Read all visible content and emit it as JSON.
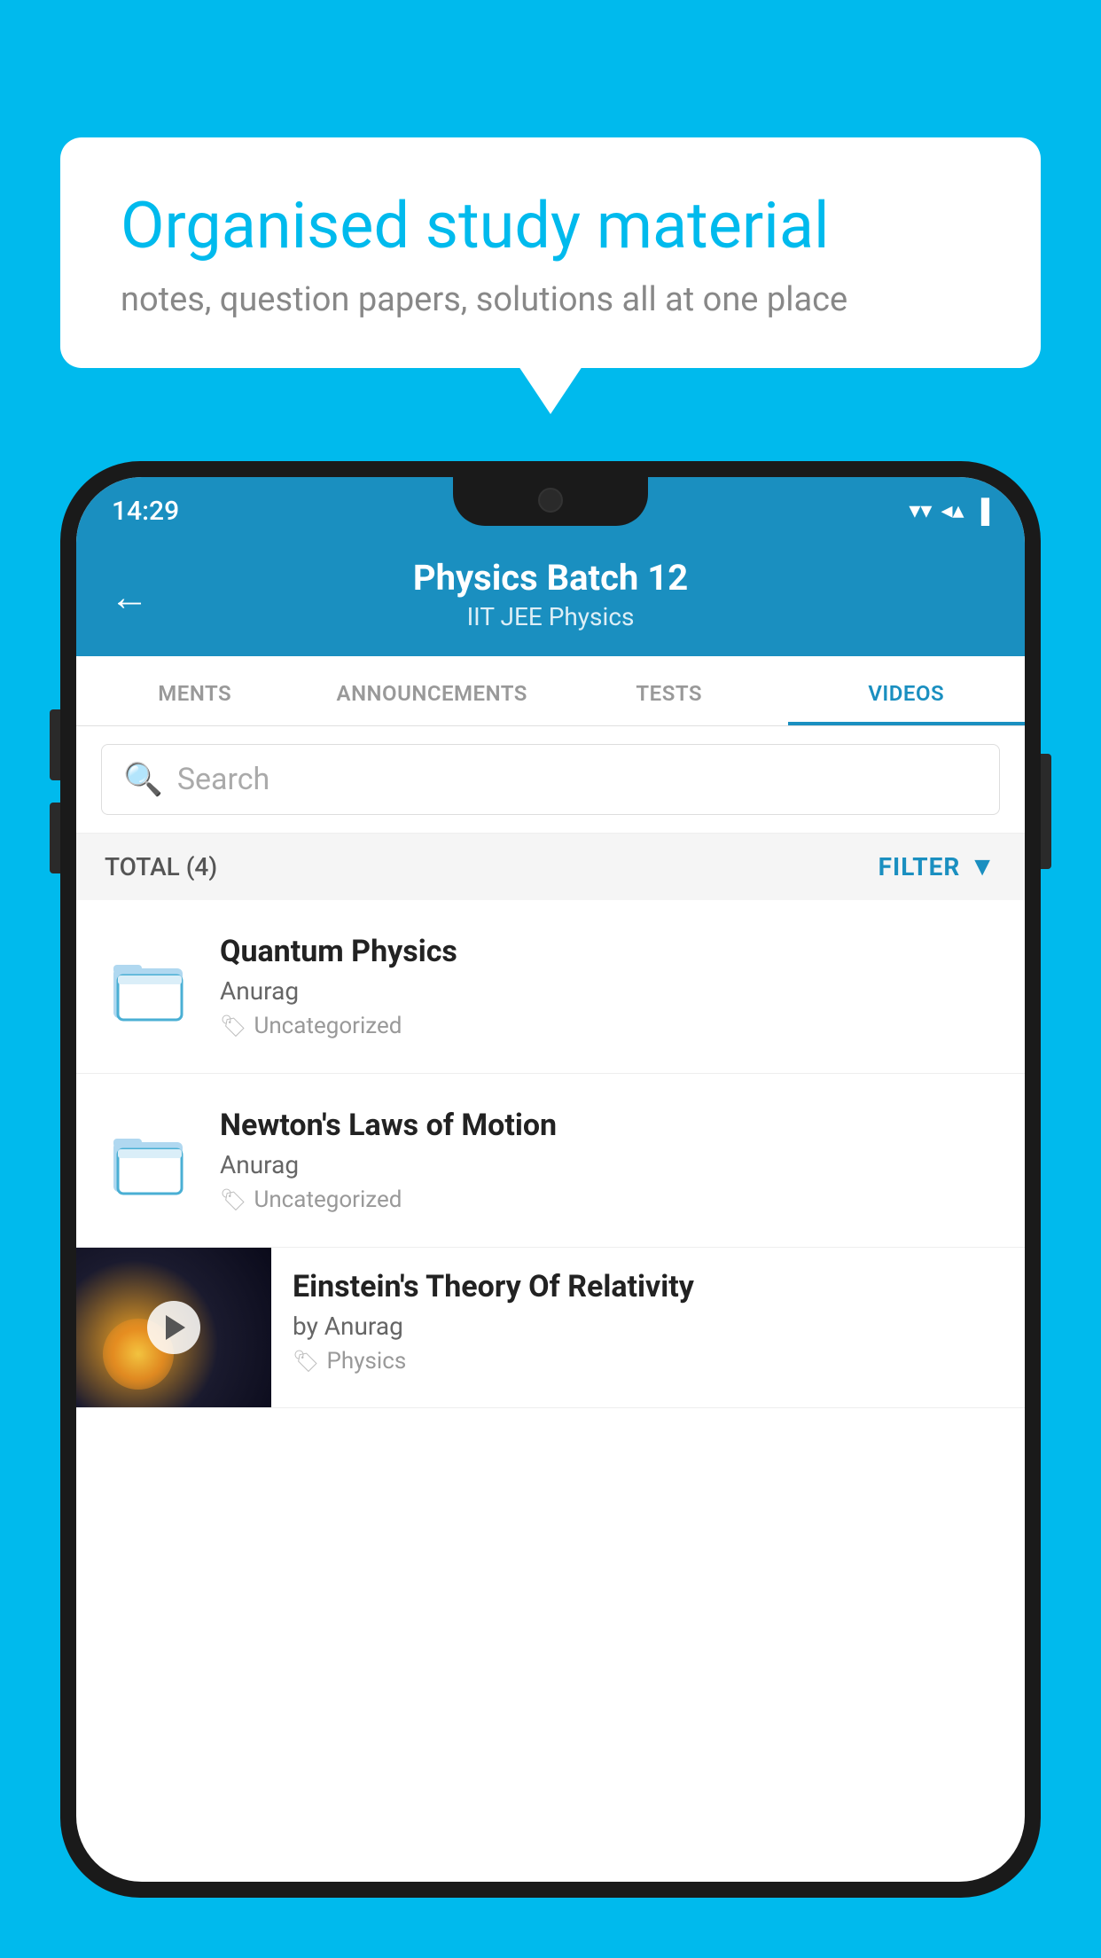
{
  "background_color": "#00BAED",
  "speech_bubble": {
    "title": "Organised study material",
    "subtitle": "notes, question papers, solutions all at one place"
  },
  "status_bar": {
    "time": "14:29",
    "wifi": "▾",
    "signal": "▲",
    "battery": "▐"
  },
  "header": {
    "title": "Physics Batch 12",
    "subtitle": "IIT JEE   Physics",
    "back_label": "←"
  },
  "tabs": [
    {
      "label": "MENTS",
      "active": false
    },
    {
      "label": "ANNOUNCEMENTS",
      "active": false
    },
    {
      "label": "TESTS",
      "active": false
    },
    {
      "label": "VIDEOS",
      "active": true
    }
  ],
  "search": {
    "placeholder": "Search"
  },
  "filter_row": {
    "total_label": "TOTAL (4)",
    "filter_label": "FILTER"
  },
  "videos": [
    {
      "title": "Quantum Physics",
      "author": "Anurag",
      "tag": "Uncategorized",
      "has_thumbnail": false
    },
    {
      "title": "Newton's Laws of Motion",
      "author": "Anurag",
      "tag": "Uncategorized",
      "has_thumbnail": false
    },
    {
      "title": "Einstein's Theory Of Relativity",
      "author": "by Anurag",
      "tag": "Physics",
      "has_thumbnail": true
    }
  ]
}
